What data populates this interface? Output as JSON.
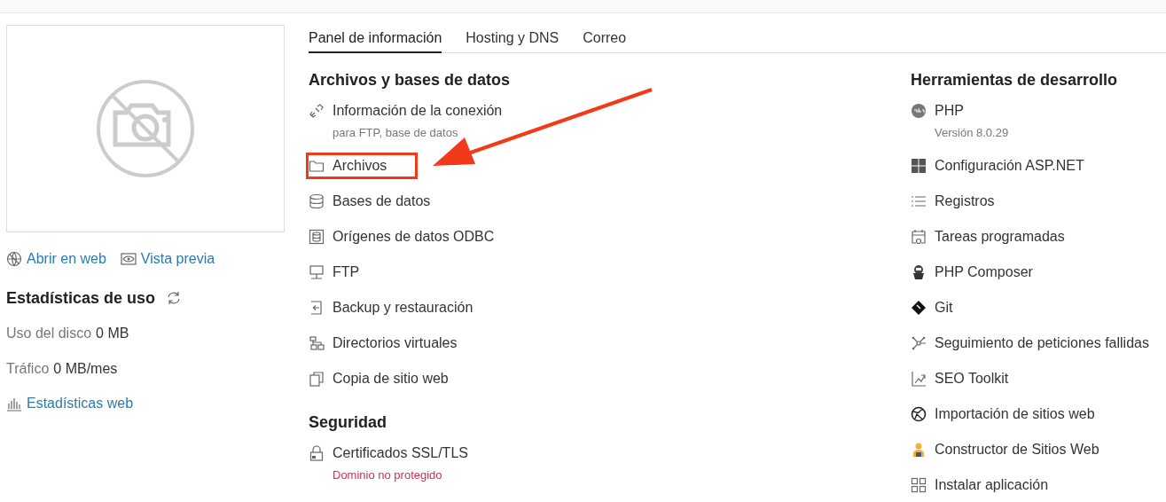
{
  "sidebar": {
    "links": [
      {
        "label": "Abrir en web"
      },
      {
        "label": "Vista previa"
      }
    ],
    "stats": {
      "title": "Estadísticas de uso",
      "rows": [
        {
          "label": "Uso del disco",
          "value": "0 MB"
        },
        {
          "label": "Tráfico",
          "value": "0 MB/mes"
        }
      ],
      "link": "Estadísticas web"
    }
  },
  "tabs": [
    {
      "label": "Panel de información",
      "selected": true
    },
    {
      "label": "Hosting y DNS",
      "selected": false
    },
    {
      "label": "Correo",
      "selected": false
    }
  ],
  "sections": [
    {
      "title": "Archivos y bases de datos",
      "items": [
        {
          "label": "Información de la conexión",
          "description": "para FTP, base de datos",
          "warning": false,
          "highlighted": false
        },
        {
          "label": "Archivos",
          "highlighted": true
        },
        {
          "label": "Bases de datos",
          "highlighted": false
        },
        {
          "label": "Orígenes de datos ODBC",
          "highlighted": false
        },
        {
          "label": "FTP",
          "highlighted": false
        },
        {
          "label": "Backup y restauración",
          "highlighted": false
        },
        {
          "label": "Directorios virtuales",
          "highlighted": false
        },
        {
          "label": "Copia de sitio web",
          "highlighted": false
        }
      ]
    },
    {
      "title": "Seguridad",
      "items": [
        {
          "label": "Certificados SSL/TLS",
          "description": "Dominio no protegido",
          "warning": true,
          "highlighted": false
        }
      ]
    },
    {
      "title": "Herramientas de desarrollo",
      "items": [
        {
          "label": "PHP",
          "description": "Versión 8.0.29",
          "warning": false,
          "highlighted": false
        },
        {
          "label": "Configuración ASP.NET",
          "highlighted": false
        },
        {
          "label": "Registros",
          "highlighted": false
        },
        {
          "label": "Tareas programadas",
          "highlighted": false
        },
        {
          "label": "PHP Composer",
          "highlighted": false
        },
        {
          "label": "Git",
          "highlighted": false
        },
        {
          "label": "Seguimiento de peticiones fallidas",
          "highlighted": false
        },
        {
          "label": "SEO Toolkit",
          "highlighted": false
        },
        {
          "label": "Importación de sitios web",
          "highlighted": false
        },
        {
          "label": "Constructor de Sitios Web",
          "highlighted": false
        },
        {
          "label": "Instalar aplicación",
          "highlighted": false
        }
      ]
    }
  ]
}
